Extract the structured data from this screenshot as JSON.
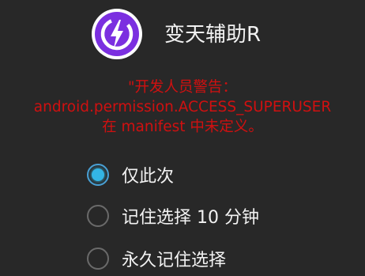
{
  "app": {
    "name": "变天辅助R",
    "icon": "lightning-bolt-icon",
    "icon_color": "#7b2fe0"
  },
  "warning": {
    "line1": "\"开发人员警告：",
    "line2": "android.permission.ACCESS_SUPERUSER",
    "line3": "在 manifest 中未定义。",
    "color": "#d01010"
  },
  "options": [
    {
      "label": "仅此次",
      "selected": true
    },
    {
      "label": "记住选择 10 分钟",
      "selected": false
    },
    {
      "label": "永久记住选择",
      "selected": false
    }
  ],
  "accent_color": "#33b5e5"
}
